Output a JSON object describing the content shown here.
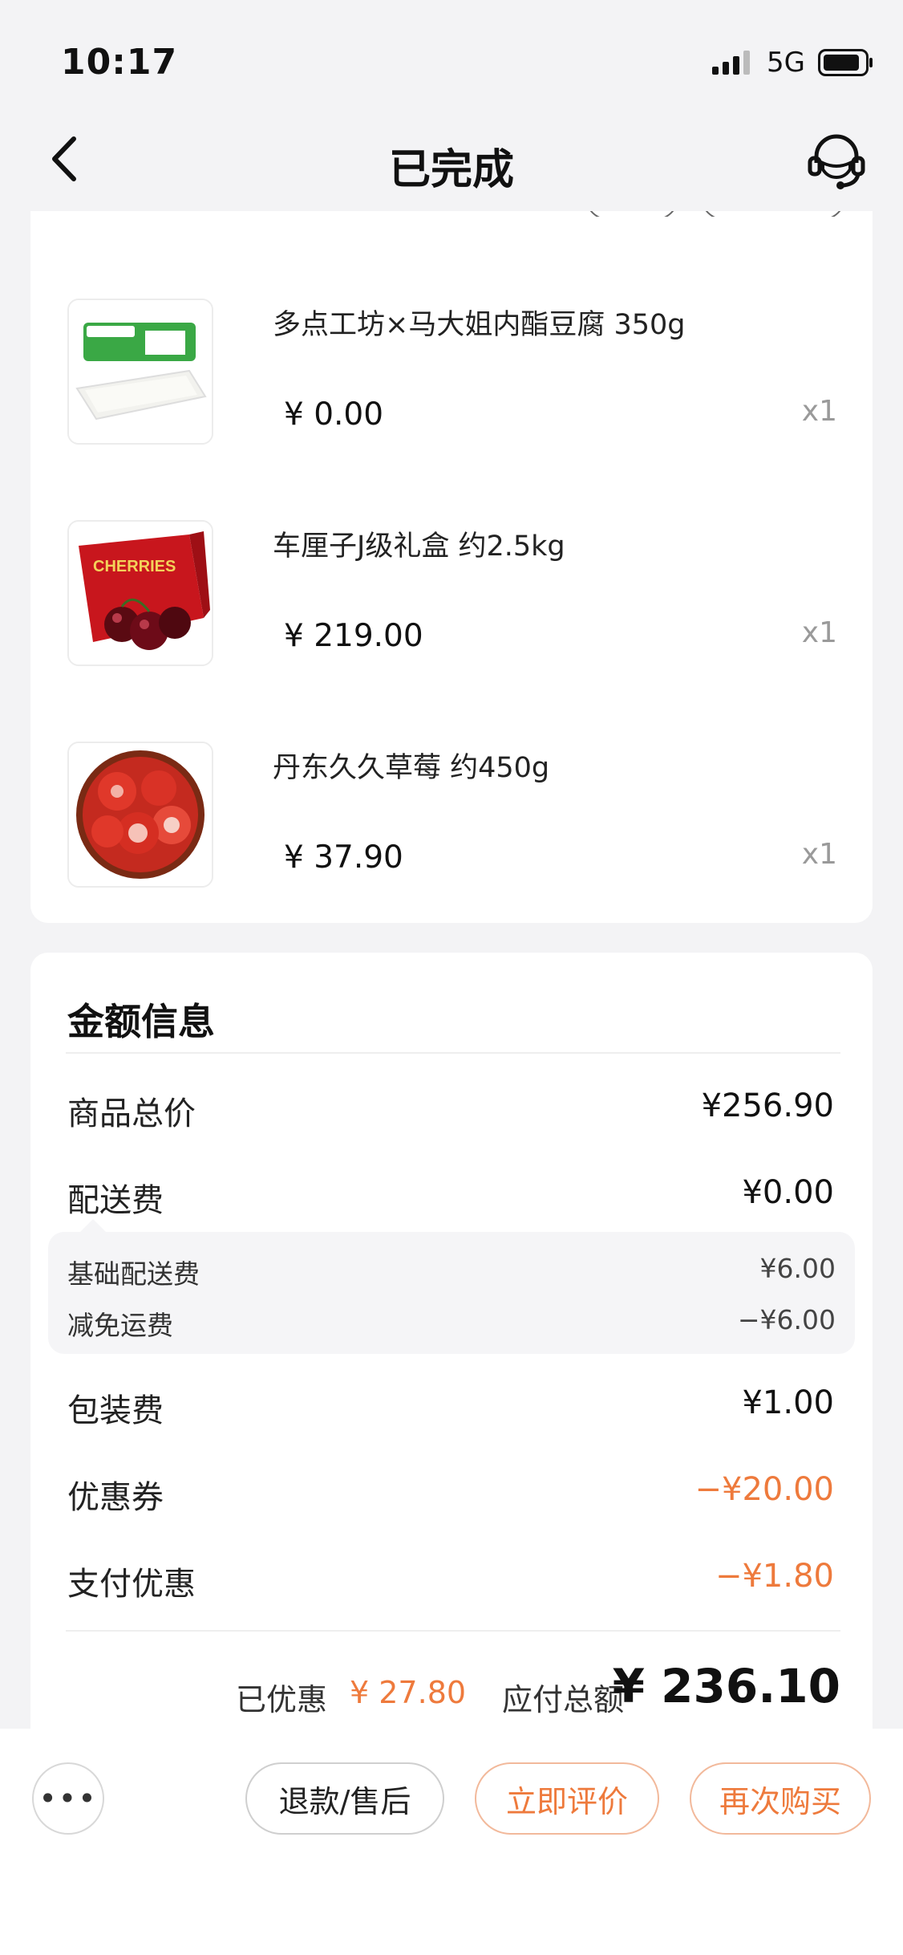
{
  "status_bar": {
    "time": "10:17",
    "network": "5G"
  },
  "nav": {
    "title": "已完成"
  },
  "items": [
    {
      "name": "多点工坊×马大姐内酯豆腐 350g",
      "price": "¥ 0.00",
      "qty": "x1",
      "thumb": "tofu"
    },
    {
      "name": "车厘子J级礼盒 约2.5kg",
      "price": "¥ 219.00",
      "qty": "x1",
      "thumb": "cherries",
      "thumb_text": "CHERRIES"
    },
    {
      "name": "丹东久久草莓 约450g",
      "price": "¥ 37.90",
      "qty": "x1",
      "thumb": "strawberries"
    }
  ],
  "amount": {
    "title": "金额信息",
    "rows": [
      {
        "label": "商品总价",
        "value": "¥256.90"
      },
      {
        "label": "配送费",
        "value": "¥0.00"
      },
      {
        "label": "包装费",
        "value": "¥1.00"
      },
      {
        "label": "优惠券",
        "value": "−¥20.00"
      },
      {
        "label": "支付优惠",
        "value": "−¥1.80"
      }
    ],
    "delivery_details": [
      {
        "label": "基础配送费",
        "value": "¥6.00"
      },
      {
        "label": "减免运费",
        "value": "−¥6.00"
      }
    ],
    "saved_label": "已优惠",
    "saved_value": "¥ 27.80",
    "total_label": "应付总额",
    "total_value": "¥ 236.10"
  },
  "bottom_bar": {
    "more": "•••",
    "refund": "退款/售后",
    "review": "立即评价",
    "rebuy": "再次购买"
  },
  "colors": {
    "accent": "#ee7a3c",
    "background": "#f3f3f5"
  }
}
